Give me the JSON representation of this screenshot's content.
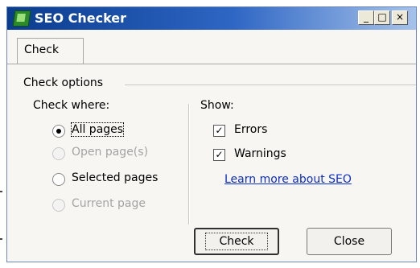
{
  "window": {
    "title": "SEO Checker",
    "caption_buttons": {
      "minimize": "_",
      "maximize": "□",
      "close": "×"
    }
  },
  "tabs": [
    {
      "label": "Check",
      "selected": true
    }
  ],
  "check_options": {
    "group_label": "Check options",
    "check_where": {
      "label": "Check where:",
      "options": [
        {
          "label": "All pages",
          "selected": true,
          "enabled": true
        },
        {
          "label": "Open page(s)",
          "selected": false,
          "enabled": false
        },
        {
          "label": "Selected pages",
          "selected": false,
          "enabled": true
        },
        {
          "label": "Current page",
          "selected": false,
          "enabled": false
        }
      ]
    },
    "show": {
      "label": "Show:",
      "errors_label": "Errors",
      "errors_checked": true,
      "warnings_label": "Warnings",
      "warnings_checked": true,
      "learn_more_link": "Learn more about SEO"
    }
  },
  "buttons": {
    "check": "Check",
    "close": "Close"
  }
}
